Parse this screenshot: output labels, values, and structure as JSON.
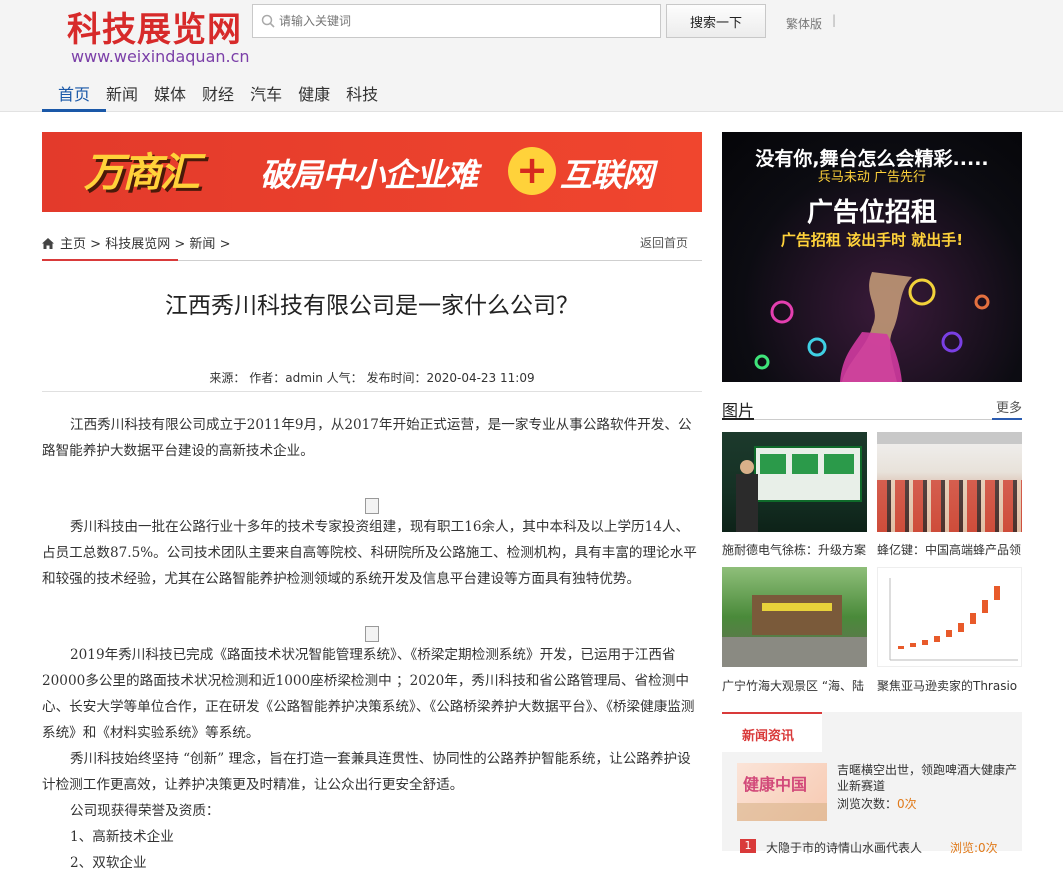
{
  "header": {
    "logo_title": "科技展览网",
    "logo_url": "www.weixindaquan.cn",
    "search_placeholder": "请输入关键词",
    "search_button": "搜索一下",
    "traditional": "繁体版",
    "separator": "|"
  },
  "nav": {
    "items": [
      "首页",
      "新闻",
      "媒体",
      "财经",
      "汽车",
      "健康",
      "科技"
    ],
    "active_index": 0
  },
  "banner": {
    "brand": "万商汇",
    "slogan": "破局中小企业难",
    "plus": "+",
    "suffix": "互联网"
  },
  "breadcrumb": {
    "home": "主页",
    "sep": ">",
    "site": "科技展览网",
    "section": "新闻",
    "back": "返回首页"
  },
  "article": {
    "title": "江西秀川科技有限公司是一家什么公司？",
    "meta": "来源： 作者：admin 人气： 发布时间：2020-04-23 11:09",
    "p1": "江西秀川科技有限公司成立于2011年9月，从2017年开始正式运营，是一家专业从事公路软件开发、公路智能养护大数据平台建设的高新技术企业。",
    "p2": "秀川科技由一批在公路行业十多年的技术专家投资组建，现有职工16余人，其中本科及以上学历14人、占员工总数87.5%。公司技术团队主要来自高等院校、科研院所及公路施工、检测机构，具有丰富的理论水平和较强的技术经验，尤其在公路智能养护检测领域的系统开发及信息平台建设等方面具有独特优势。",
    "p3": "2019年秀川科技已完成《路面技术状况智能管理系统》、《桥梁定期检测系统》开发，已运用于江西省20000多公里的路面技术状况检测和近1000座桥梁检测中 ；2020年，秀川科技和省公路管理局、省检测中心、长安大学等单位合作，正在研发《公路智能养护决策系统》、《公路桥梁养护大数据平台》、《桥梁健康监测系统》和《材料实验系统》等系统。",
    "p4": "秀川科技始终坚持 “创新” 理念，旨在打造一套兼具连贯性、协同性的公路养护智能系统，让公路养护设计检测工作更高效，让养护决策更及时精准，让公众出行更安全舒适。",
    "p5": "公司现获得荣誉及资质：",
    "p6": "1、高新技术企业",
    "p7": "2、双软企业"
  },
  "ad": {
    "line1": "没有你,舞台怎么会精彩.....",
    "line2": "兵马未动 广告先行",
    "line3": "广告位招租",
    "line4": "广告招租 该出手时 就出手!"
  },
  "pictures": {
    "title": "图片",
    "more": "更多",
    "items": [
      {
        "caption": "施耐德电气徐栋：升级方案"
      },
      {
        "caption": "蜂亿键：中国高端蜂产品领"
      },
      {
        "caption": "广宁竹海大观景区 “海、陆"
      },
      {
        "caption": "聚焦亚马逊卖家的Thrasio"
      }
    ]
  },
  "news": {
    "tab": "新闻资讯",
    "featured_title": "吉暱横空出世，领跑啤酒大健康产业新赛道",
    "views_label": "浏览次数：",
    "views_value": "0次",
    "thumb_text": "健康中国",
    "rank1": "1",
    "rank1_title": "大隐于市的诗情山水画代表人",
    "rank1_views": "浏览:0次"
  },
  "colors": {
    "brand_red": "#d72a2a",
    "nav_active": "#1a58a8",
    "url_purple": "#7b3fa8",
    "accent_orange": "#e07a1a"
  }
}
